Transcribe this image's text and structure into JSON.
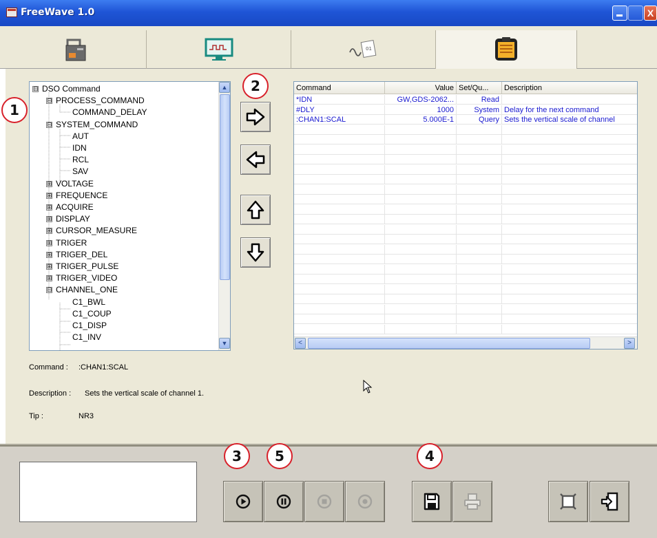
{
  "window": {
    "title": "FreeWave 1.0",
    "close_glyph": "X"
  },
  "tabs": [
    {
      "icon": "instrument-connect-icon"
    },
    {
      "icon": "waveform-monitor-icon"
    },
    {
      "icon": "waveform-document-icon"
    },
    {
      "icon": "command-list-icon",
      "selected": true
    }
  ],
  "tree": {
    "nodes": [
      {
        "label": "DSO Command",
        "expander": "⊟",
        "level": 0
      },
      {
        "label": "PROCESS_COMMAND",
        "expander": "⊟",
        "level": 1
      },
      {
        "label": "COMMAND_DELAY",
        "expander": "",
        "level": 2
      },
      {
        "label": "SYSTEM_COMMAND",
        "expander": "⊟",
        "level": 1
      },
      {
        "label": "AUT",
        "expander": "",
        "level": 2
      },
      {
        "label": "IDN",
        "expander": "",
        "level": 2
      },
      {
        "label": "RCL",
        "expander": "",
        "level": 2
      },
      {
        "label": "SAV",
        "expander": "",
        "level": 2
      },
      {
        "label": "VOLTAGE",
        "expander": "⊞",
        "level": 1
      },
      {
        "label": "FREQUENCE",
        "expander": "⊞",
        "level": 1
      },
      {
        "label": "ACQUIRE",
        "expander": "⊞",
        "level": 1
      },
      {
        "label": "DISPLAY",
        "expander": "⊞",
        "level": 1
      },
      {
        "label": "CURSOR_MEASURE",
        "expander": "⊞",
        "level": 1
      },
      {
        "label": "TRIGER",
        "expander": "⊞",
        "level": 1
      },
      {
        "label": "TRIGER_DEL",
        "expander": "⊞",
        "level": 1
      },
      {
        "label": "TRIGER_PULSE",
        "expander": "⊞",
        "level": 1
      },
      {
        "label": "TRIGER_VIDEO",
        "expander": "⊞",
        "level": 1
      },
      {
        "label": "CHANNEL_ONE",
        "expander": "⊟",
        "level": 1
      },
      {
        "label": "C1_BWL",
        "expander": "",
        "level": 2
      },
      {
        "label": "C1_COUP",
        "expander": "",
        "level": 2
      },
      {
        "label": "C1_DISP",
        "expander": "",
        "level": 2
      },
      {
        "label": "C1_INV",
        "expander": "",
        "level": 2
      }
    ],
    "scroll_up": "▲",
    "scroll_down": "▼"
  },
  "arrow_buttons": [
    {
      "icon": "arrow-right-icon"
    },
    {
      "icon": "arrow-left-icon"
    },
    {
      "icon": "arrow-up-icon"
    },
    {
      "icon": "arrow-down-icon"
    }
  ],
  "table": {
    "columns": [
      "Command",
      "Value",
      "Set/Qu...",
      "Description"
    ],
    "rows": [
      [
        "*IDN",
        "GW,GDS-2062...",
        "Read",
        ""
      ],
      [
        "#DLY",
        "1000",
        "System",
        "Delay for the next command"
      ],
      [
        ":CHAN1:SCAL",
        "5.000E-1",
        "Query",
        "Sets the vertical scale of channel"
      ]
    ],
    "scroll_left": "<",
    "scroll_right": ">"
  },
  "info": {
    "command_label": "Command :",
    "command_value": ":CHAN1:SCAL",
    "description_label": "Description :",
    "description_value": "Sets the vertical scale of channel 1.",
    "tip_label": "Tip :",
    "tip_value": "NR3"
  },
  "callouts": [
    "1",
    "2",
    "3",
    "5",
    "4"
  ],
  "bottom_buttons": [
    {
      "icon": "play-icon",
      "enabled": true
    },
    {
      "icon": "pause-icon",
      "enabled": true
    },
    {
      "icon": "stop-icon",
      "enabled": false
    },
    {
      "icon": "record-icon",
      "enabled": false
    },
    {
      "icon": "save-icon",
      "enabled": true
    },
    {
      "icon": "print-icon",
      "enabled": false
    },
    {
      "icon": "fullscreen-icon",
      "enabled": true
    },
    {
      "icon": "exit-icon",
      "enabled": true
    }
  ],
  "colors": {
    "titlebar": "#1f55d6",
    "table_text": "#1a1ad0",
    "callout_border": "#d8202a",
    "panel": "#ece9d8"
  }
}
